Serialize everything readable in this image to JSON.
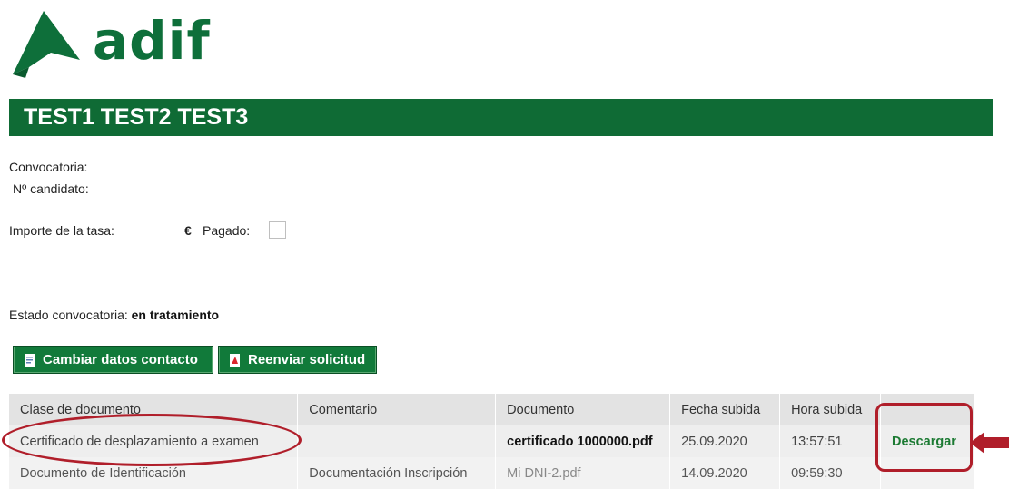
{
  "logo": {
    "text": "adif"
  },
  "banner": {
    "title": "TEST1 TEST2 TEST3"
  },
  "info": {
    "convocatoria_label": "Convocatoria:",
    "candidato_label": "Nº candidato:",
    "importe_label": "Importe de la tasa:",
    "currency": "€",
    "pagado_label": "Pagado:",
    "pagado_checked": false,
    "estado_label": "Estado convocatoria:",
    "estado_value": "en tratamiento"
  },
  "buttons": {
    "cambiar_label": "Cambiar datos contacto",
    "reenviar_label": "Reenviar solicitud"
  },
  "table": {
    "headers": [
      "Clase de documento",
      "Comentario",
      "Documento",
      "Fecha subida",
      "Hora subida",
      ""
    ],
    "rows": [
      {
        "clase": "Certificado de desplazamiento a examen",
        "comentario": "",
        "documento": "certificado 1000000.pdf",
        "fecha": "25.09.2020",
        "hora": "13:57:51",
        "accion": "Descargar"
      },
      {
        "clase": "Documento de Identificación",
        "comentario": "Documentación Inscripción",
        "documento": "Mi DNI-2.pdf",
        "fecha": "14.09.2020",
        "hora": "09:59:30",
        "accion": ""
      }
    ]
  },
  "colors": {
    "brand_green": "#0f6b35",
    "button_green": "#117a3a",
    "link_green": "#1c7a33",
    "annotation_red": "#b01e2a"
  }
}
